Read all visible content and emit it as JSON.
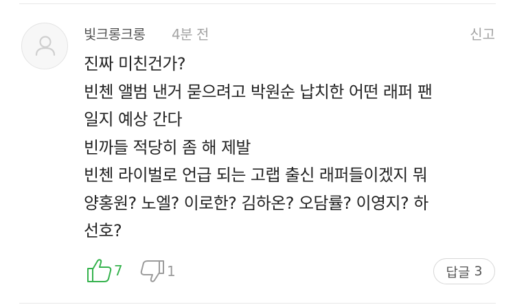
{
  "comment": {
    "author": "빛크롱크롱",
    "time": "4분 전",
    "report_label": "신고",
    "lines": [
      "진짜 미친건가?",
      "빈첸 앨범 낸거 묻으려고 박원순 납치한 어떤 래퍼 팬",
      "일지 예상 간다",
      "빈까들 적당히 좀 해 제발",
      "빈첸 라이벌로 언급 되는 고랩 출신 래퍼들이겠지 뭐",
      "양홍원? 노엘? 이로한? 김하온? 오담률? 이영지? 하",
      "선호?"
    ],
    "like_count": "7",
    "dislike_count": "1",
    "reply": {
      "label": "답글",
      "count": "3"
    }
  },
  "icons": {
    "avatar": "user-silhouette-icon",
    "like": "thumbs-up-icon",
    "dislike": "thumbs-down-icon"
  },
  "colors": {
    "like_accent": "#34b24c",
    "muted_text": "#a3a3a3",
    "body_text": "#222222"
  }
}
